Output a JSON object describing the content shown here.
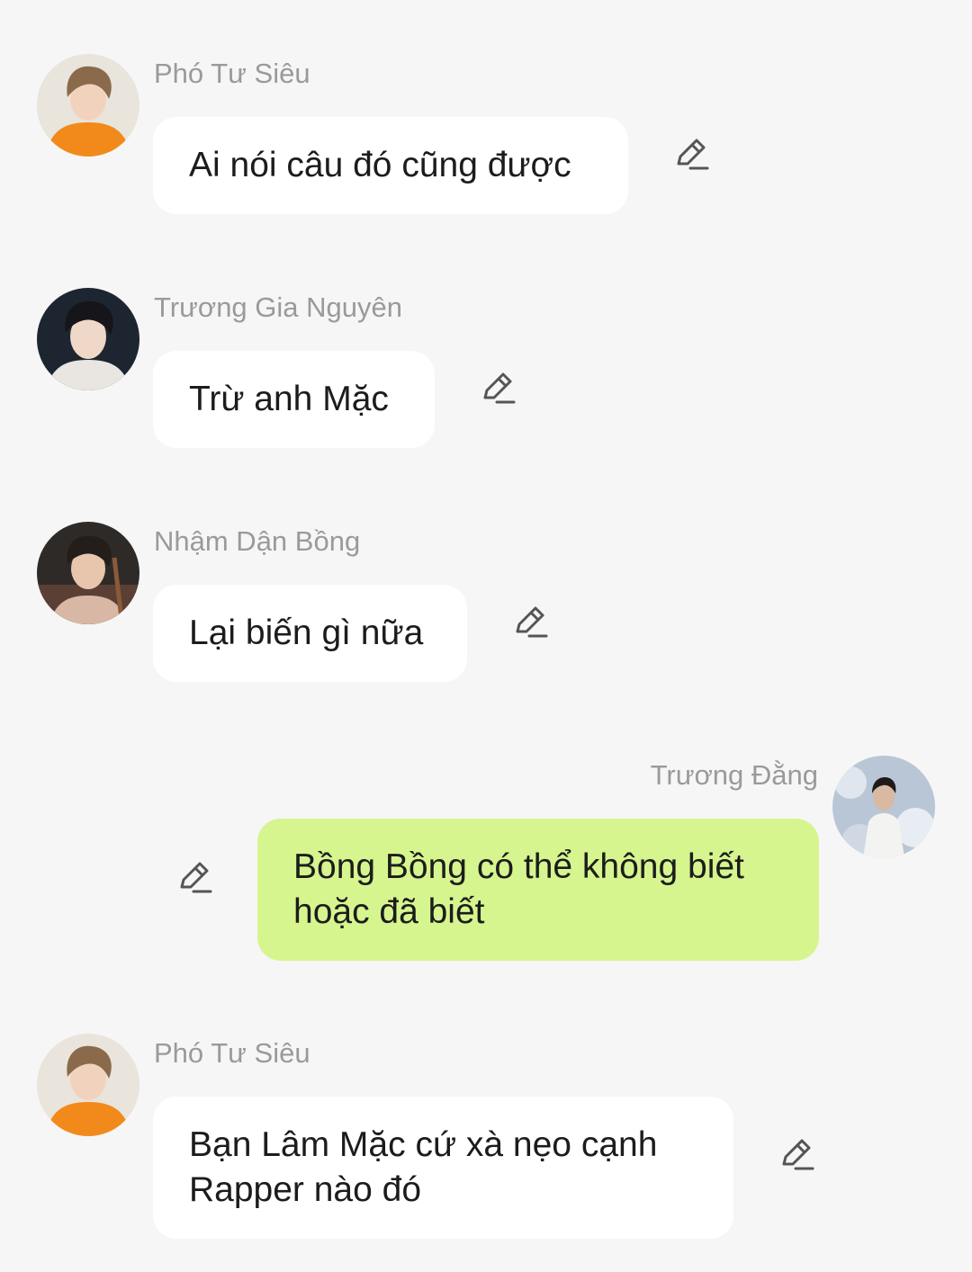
{
  "colors": {
    "background": "#f6f6f6",
    "bubble_other": "#ffffff",
    "bubble_self": "#d6f58e",
    "sender_name": "#9a9a9a",
    "message_text": "#1c1c1c",
    "icon": "#555555"
  },
  "messages": [
    {
      "sender": "Phó Tư Siêu",
      "text": "Ai nói câu đó cũng được",
      "side": "left",
      "avatar": "avatar-pho-tu-sieu",
      "action_icon": "edit-pencil-icon"
    },
    {
      "sender": "Trương Gia Nguyên",
      "text": "Trừ anh Mặc",
      "side": "left",
      "avatar": "avatar-truong-gia-nguyen",
      "action_icon": "edit-pencil-icon"
    },
    {
      "sender": "Nhậm Dận Bồng",
      "text": "Lại biến gì nữa",
      "side": "left",
      "avatar": "avatar-nham-dan-bong",
      "action_icon": "edit-pencil-icon"
    },
    {
      "sender": "Trương Đằng",
      "text": "Bồng Bồng có thể không biết\nhoặc đã biết",
      "side": "right",
      "avatar": "avatar-truong-dang",
      "action_icon": "edit-pencil-icon"
    },
    {
      "sender": "Phó Tư Siêu",
      "text": "Bạn Lâm Mặc cứ xà nẹo cạnh\nRapper nào đó",
      "side": "left",
      "avatar": "avatar-pho-tu-sieu",
      "action_icon": "edit-pencil-icon"
    }
  ]
}
